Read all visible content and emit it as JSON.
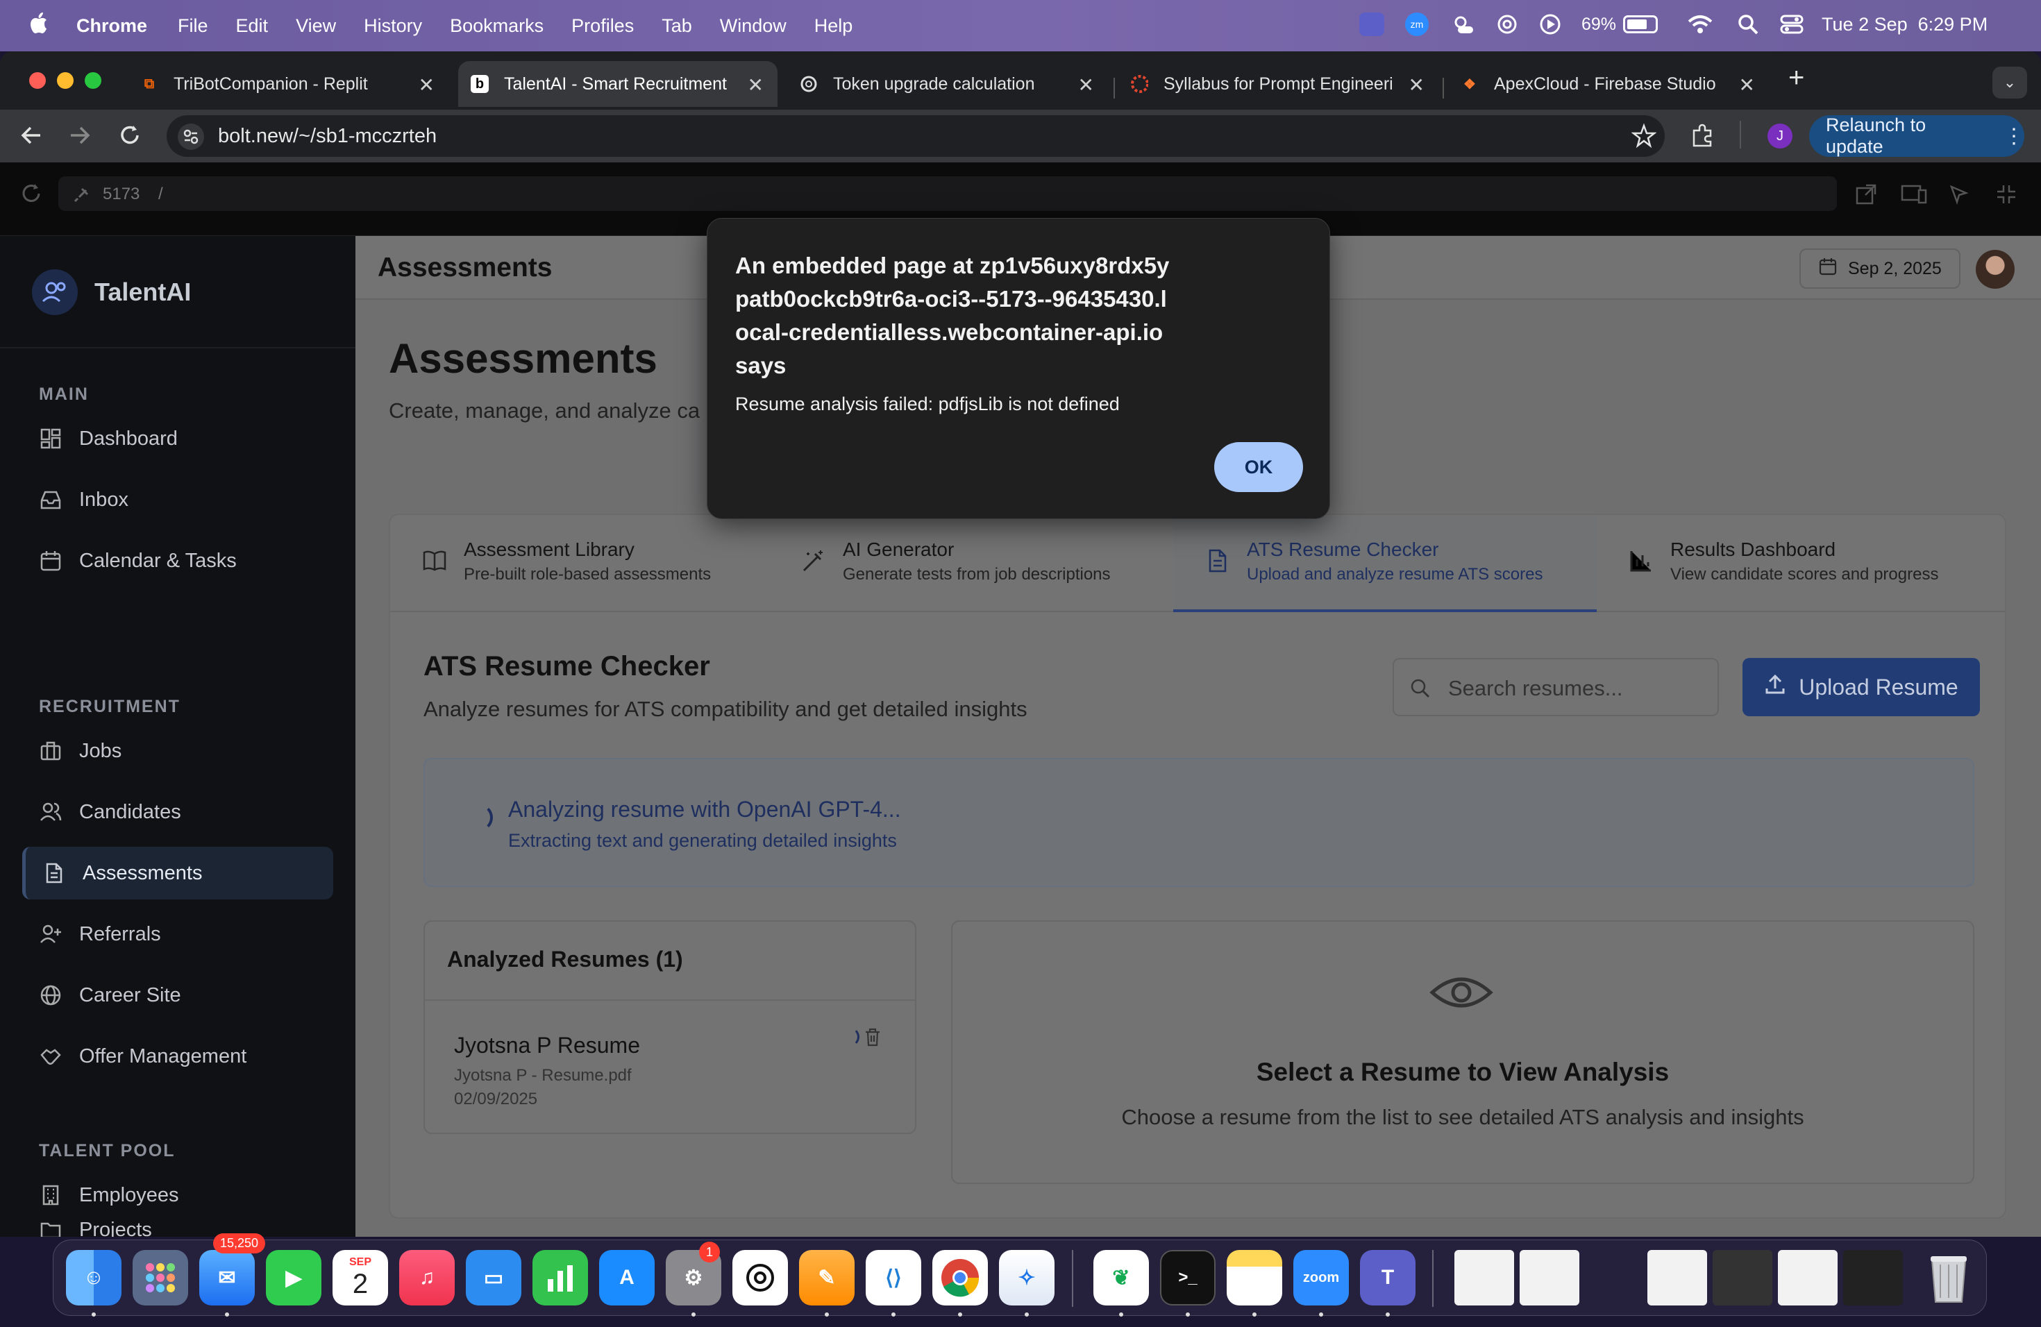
{
  "menubar": {
    "apple": "",
    "app": "Chrome",
    "items": [
      "File",
      "Edit",
      "View",
      "History",
      "Bookmarks",
      "Profiles",
      "Tab",
      "Window",
      "Help"
    ],
    "battery": "69%",
    "datetime": "Tue 2 Sep  6:29 PM"
  },
  "browser": {
    "tabs": [
      {
        "title": "TriBotCompanion - Replit"
      },
      {
        "title": "TalentAI - Smart Recruitment"
      },
      {
        "title": "Token upgrade calculation"
      },
      {
        "title": "Syllabus for Prompt Engineeri"
      },
      {
        "title": "ApexCloud - Firebase Studio"
      }
    ],
    "url": "bolt.new/~/sb1-mcczrteh",
    "profile_initial": "J",
    "relaunch_label": "Relaunch to update"
  },
  "preview": {
    "port": "5173",
    "path": "/"
  },
  "sidebar": {
    "brand": "TalentAI",
    "sections": [
      {
        "title": "MAIN",
        "items": [
          "Dashboard",
          "Inbox",
          "Calendar & Tasks"
        ]
      },
      {
        "title": "RECRUITMENT",
        "items": [
          "Jobs",
          "Candidates",
          "Assessments",
          "Referrals",
          "Career Site",
          "Offer Management"
        ]
      },
      {
        "title": "TALENT POOL",
        "items": [
          "Employees",
          "Projects"
        ]
      }
    ]
  },
  "header": {
    "title": "Assessments",
    "date": "Sep 2, 2025"
  },
  "page": {
    "title": "Assessments",
    "subtitle": "Create, manage, and analyze ca"
  },
  "tabs": [
    {
      "title": "Assessment Library",
      "subtitle": "Pre-built role-based assessments",
      "icon": "book-icon"
    },
    {
      "title": "AI Generator",
      "subtitle": "Generate tests from job descriptions",
      "icon": "magic-wand-icon"
    },
    {
      "title": "ATS Resume Checker",
      "subtitle": "Upload and analyze resume ATS scores",
      "icon": "document-icon",
      "active": true
    },
    {
      "title": "Results Dashboard",
      "subtitle": "View candidate scores and progress",
      "icon": "bar-chart-icon"
    }
  ],
  "ats": {
    "title": "ATS Resume Checker",
    "subtitle": "Analyze resumes for ATS compatibility and get detailed insights",
    "search_placeholder": "Search resumes...",
    "upload_label": "Upload Resume",
    "analyzing_title": "Analyzing resume with OpenAI GPT-4...",
    "analyzing_sub": "Extracting text and generating detailed insights",
    "list_title": "Analyzed Resumes (1)",
    "resume": {
      "name": "Jyotsna P Resume",
      "file": "Jyotsna P - Resume.pdf",
      "date": "02/09/2025"
    },
    "empty_title": "Select a Resume to View Analysis",
    "empty_sub": "Choose a resume from the list to see detailed ATS analysis and insights"
  },
  "dialog": {
    "heading": "An embedded page at zp1v56uxy8rdx5ypatb0ockcb9tr6a-oci3--5173--96435430.local-credentialless.webcontainer-api.io says",
    "message": "Resume analysis failed: pdfjsLib is not defined",
    "ok_label": "OK"
  },
  "dock": {
    "mail_badge": "15,250",
    "calendar_month": "SEP",
    "calendar_day": "2",
    "settings_badge": "1",
    "zoom_label": "zoom"
  }
}
